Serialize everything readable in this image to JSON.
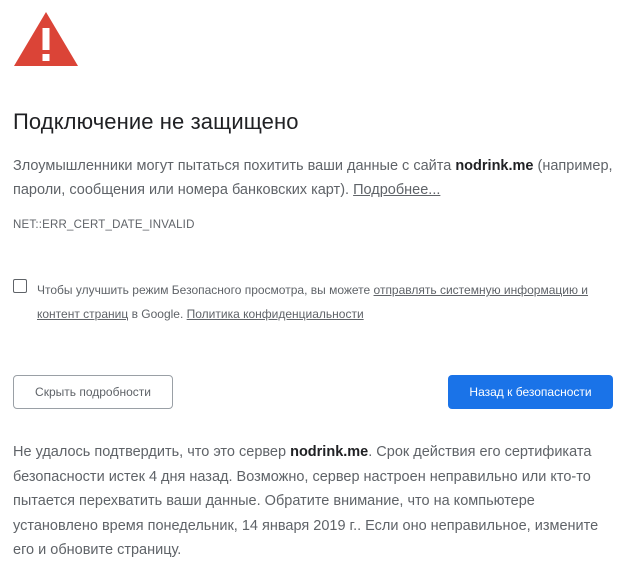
{
  "icon": "warning-triangle-icon",
  "colors": {
    "warning_red": "#db4437",
    "primary_blue": "#1a73e8",
    "text_gray": "#5f6368",
    "heading": "#202124"
  },
  "title": "Подключение не защищено",
  "main": {
    "text_before": "Злоумышленники могут пытаться похитить ваши данные с сайта ",
    "host": "nodrink.me",
    "text_after": " (например, пароли, сообщения или номера банковских карт). ",
    "more_link": "Подробнее..."
  },
  "error_code": "NET::ERR_CERT_DATE_INVALID",
  "safe_browsing": {
    "checked": false,
    "text_before": "Чтобы улучшить режим Безопасного просмотра, вы можете ",
    "link_report": "отправлять системную информацию и контент страниц",
    "text_middle": " в Google. ",
    "link_privacy": "Политика конфиденциальности"
  },
  "buttons": {
    "hide_details": "Скрыть подробности",
    "back_to_safety": "Назад к безопасности"
  },
  "details": {
    "text_before": "Не удалось подтвердить, что это сервер ",
    "host": "nodrink.me",
    "text_after": ". Срок действия его сертификата безопасности истек 4 дня назад. Возможно, сервер настроен неправильно или кто-то пытается перехватить ваши данные. Обратите внимание, что на компьютере установлено время понедельник, 14 января 2019 г.. Если оно неправильное, измените его и обновите страницу."
  }
}
